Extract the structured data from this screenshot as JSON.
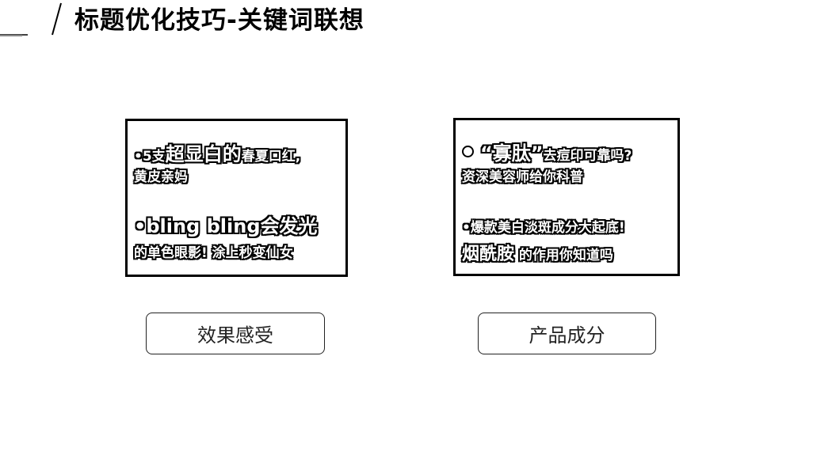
{
  "page_title": "标题优化技巧-关键词联想",
  "card_left": {
    "item1": {
      "bullet": "•",
      "num": "5支",
      "highlight": "超显白的",
      "rest": "春夏口红,",
      "line2": "黄皮亲妈"
    },
    "item2": {
      "bullet": "•",
      "highlight": "bling bling会发光",
      "line2": "的单色眼影! 涂上秒变仙女"
    }
  },
  "card_right": {
    "item1": {
      "quote": "“寡肽”",
      "rest": "去痘印可靠吗?",
      "line2": "资深美容师给你科普"
    },
    "item2": {
      "bullet": "•",
      "line1": "爆款美白淡斑成分大起底!",
      "highlight": "烟酰胺",
      "rest2": " 的作用你知道吗"
    }
  },
  "labels": {
    "left": "效果感受",
    "right": "产品成分"
  }
}
